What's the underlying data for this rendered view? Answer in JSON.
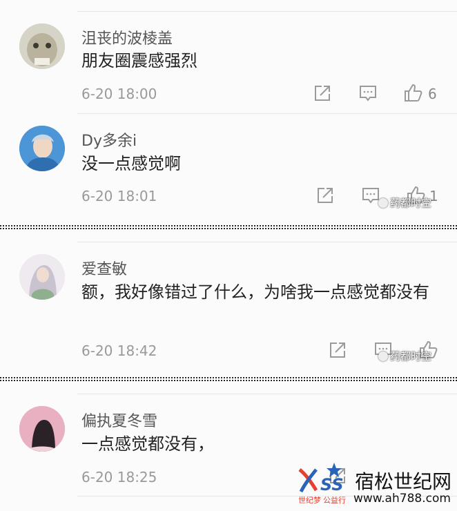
{
  "comments": [
    {
      "username": "沮丧的波棱盖",
      "text": "朋友圈震感强烈",
      "time": "6-20 18:00",
      "likes": "6"
    },
    {
      "username": "Dy多余i",
      "text": "没一点感觉啊",
      "time": "6-20 18:01",
      "likes": "1"
    },
    {
      "username": "爱查敏",
      "text": "额，我好像错过了什么，为啥我一点感觉都没有",
      "time": "6-20 18:42",
      "likes": ""
    },
    {
      "username": "偏执夏冬雪",
      "text": "一点感觉都没有，",
      "time": "6-20 18:25",
      "likes": ""
    }
  ],
  "watermark": {
    "text": "药都时空"
  },
  "brand": {
    "name": "宿松世纪网",
    "url": "www.ah788.com",
    "tag1": "世纪梦",
    "tag2": "公益行",
    "logo_letters": "SS"
  },
  "colors": {
    "icon": "#9a9a9a",
    "panel": "#fbfbfb",
    "accent_red": "#e8402e",
    "accent_blue": "#2a64b8"
  }
}
